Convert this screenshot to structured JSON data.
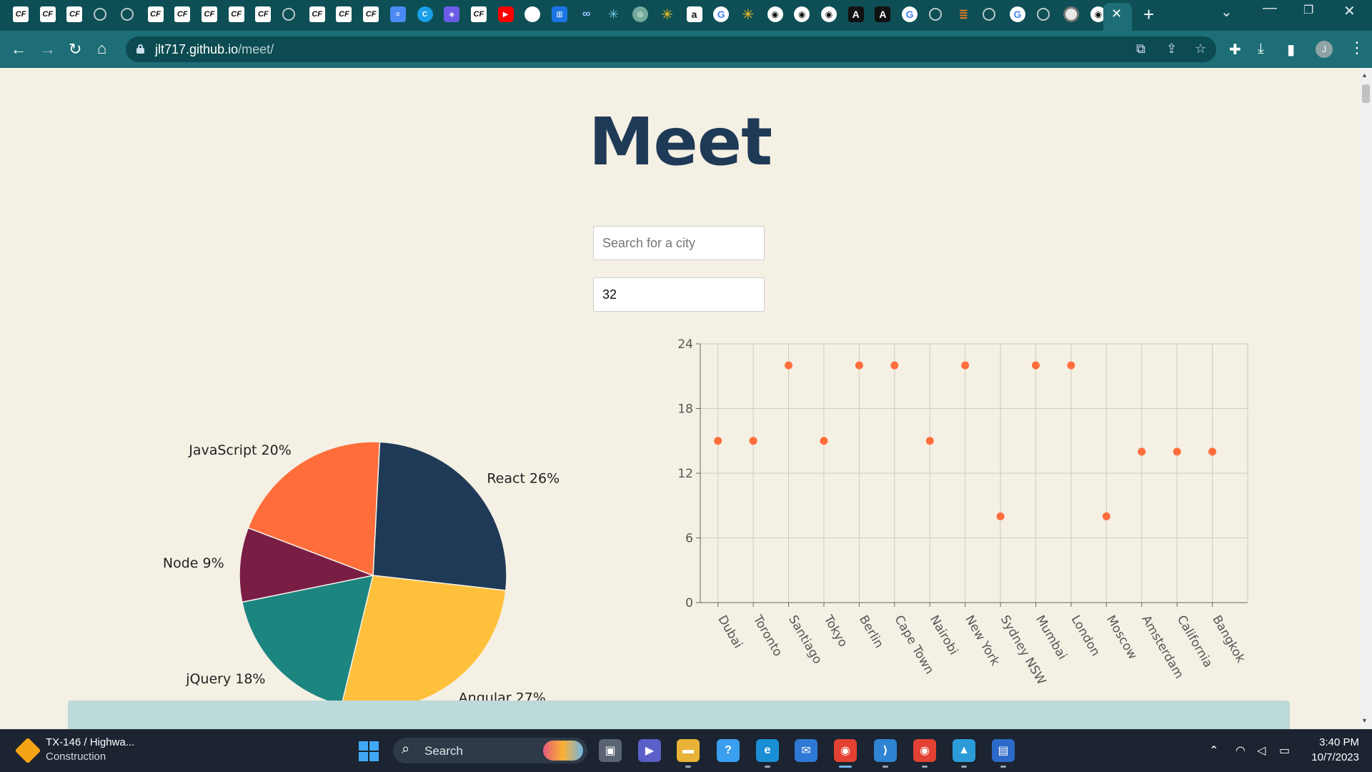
{
  "browser": {
    "url_host": "jlt717.github.io",
    "url_path": "/meet/",
    "active_tab_close": "✕",
    "new_tab": "+"
  },
  "page": {
    "title": "Meet",
    "city_search": {
      "placeholder": "Search for a city",
      "value": ""
    },
    "event_count": {
      "value": "32"
    }
  },
  "chart_data": [
    {
      "type": "pie",
      "slices": [
        {
          "label": "React 26%",
          "name": "React",
          "value": 26,
          "color": "#1f3a56"
        },
        {
          "label": "Angular 27%",
          "name": "Angular",
          "value": 27,
          "color": "#ffc13b"
        },
        {
          "label": "jQuery 18%",
          "name": "jQuery",
          "value": 18,
          "color": "#1c8580"
        },
        {
          "label": "Node 9%",
          "name": "Node",
          "value": 9,
          "color": "#7a1d45"
        },
        {
          "label": "JavaScript 20%",
          "name": "JavaScript",
          "value": 20,
          "color": "#ff6d3b"
        }
      ]
    },
    {
      "type": "scatter",
      "categories": [
        "Dubai",
        "Toronto",
        "Santiago",
        "Tokyo",
        "Berlin",
        "Cape Town",
        "Nairobi",
        "New York",
        "Sydney NSW",
        "Mumbai",
        "London",
        "Moscow",
        "Amsterdam",
        "California",
        "Bangkok"
      ],
      "values": [
        15,
        15,
        22,
        15,
        22,
        22,
        15,
        22,
        8,
        22,
        22,
        8,
        14,
        14,
        14
      ],
      "ylim": [
        0,
        24
      ],
      "yticks": [
        "0",
        "6",
        "12",
        "18",
        "24"
      ],
      "grid": true,
      "point_color": "#ff6d3b"
    }
  ],
  "taskbar": {
    "weather_title": "TX-146 / Highwa...",
    "weather_sub": "Construction",
    "search_label": "Search",
    "time": "3:40 PM",
    "date": "10/7/2023"
  }
}
